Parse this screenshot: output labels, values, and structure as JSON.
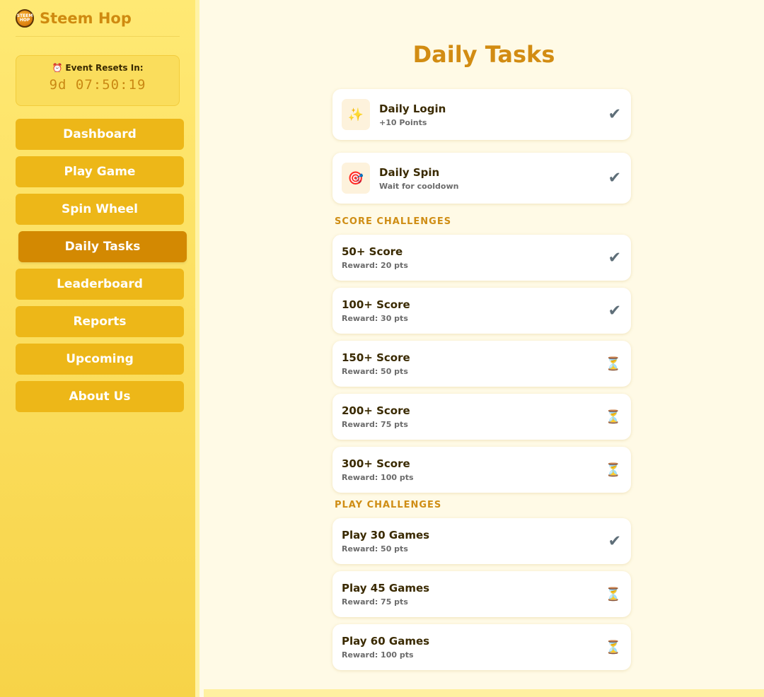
{
  "app": {
    "title": "Steem Hop",
    "logo_text": "STEEM HOP",
    "logo_icon": "coin-logo-icon"
  },
  "timer": {
    "icon": "alarm-clock-icon",
    "label": "Event Resets In:",
    "value": "9d 07:50:19"
  },
  "nav": {
    "items": [
      {
        "label": "Dashboard",
        "active": false
      },
      {
        "label": "Play Game",
        "active": false
      },
      {
        "label": "Spin Wheel",
        "active": false
      },
      {
        "label": "Daily Tasks",
        "active": true
      },
      {
        "label": "Leaderboard",
        "active": false
      },
      {
        "label": "Reports",
        "active": false
      },
      {
        "label": "Upcoming",
        "active": false
      },
      {
        "label": "About Us",
        "active": false
      }
    ]
  },
  "page": {
    "title": "Daily Tasks"
  },
  "daily": [
    {
      "icon": "sparkles-icon",
      "glyph": "✨",
      "title": "Daily Login",
      "sub": "+10 Points",
      "status": "done"
    },
    {
      "icon": "target-icon",
      "glyph": "🎯",
      "title": "Daily Spin",
      "sub": "Wait for cooldown",
      "status": "done"
    }
  ],
  "score_section": "SCORE CHALLENGES",
  "score": [
    {
      "title": "50+ Score",
      "sub": "Reward: 20 pts",
      "status": "done"
    },
    {
      "title": "100+ Score",
      "sub": "Reward: 30 pts",
      "status": "done"
    },
    {
      "title": "150+ Score",
      "sub": "Reward: 50 pts",
      "status": "pending"
    },
    {
      "title": "200+ Score",
      "sub": "Reward: 75 pts",
      "status": "pending"
    },
    {
      "title": "300+ Score",
      "sub": "Reward: 100 pts",
      "status": "pending"
    }
  ],
  "play_section": "PLAY CHALLENGES",
  "play": [
    {
      "title": "Play 30 Games",
      "sub": "Reward: 50 pts",
      "status": "done"
    },
    {
      "title": "Play 45 Games",
      "sub": "Reward: 75 pts",
      "status": "pending"
    },
    {
      "title": "Play 60 Games",
      "sub": "Reward: 100 pts",
      "status": "pending"
    }
  ],
  "status_glyphs": {
    "done": "✔",
    "pending": "⏳"
  },
  "colors": {
    "accent": "#d28c13",
    "nav_bg": "#edb718",
    "nav_active": "#d38902",
    "page_bg": "#fffae6"
  }
}
